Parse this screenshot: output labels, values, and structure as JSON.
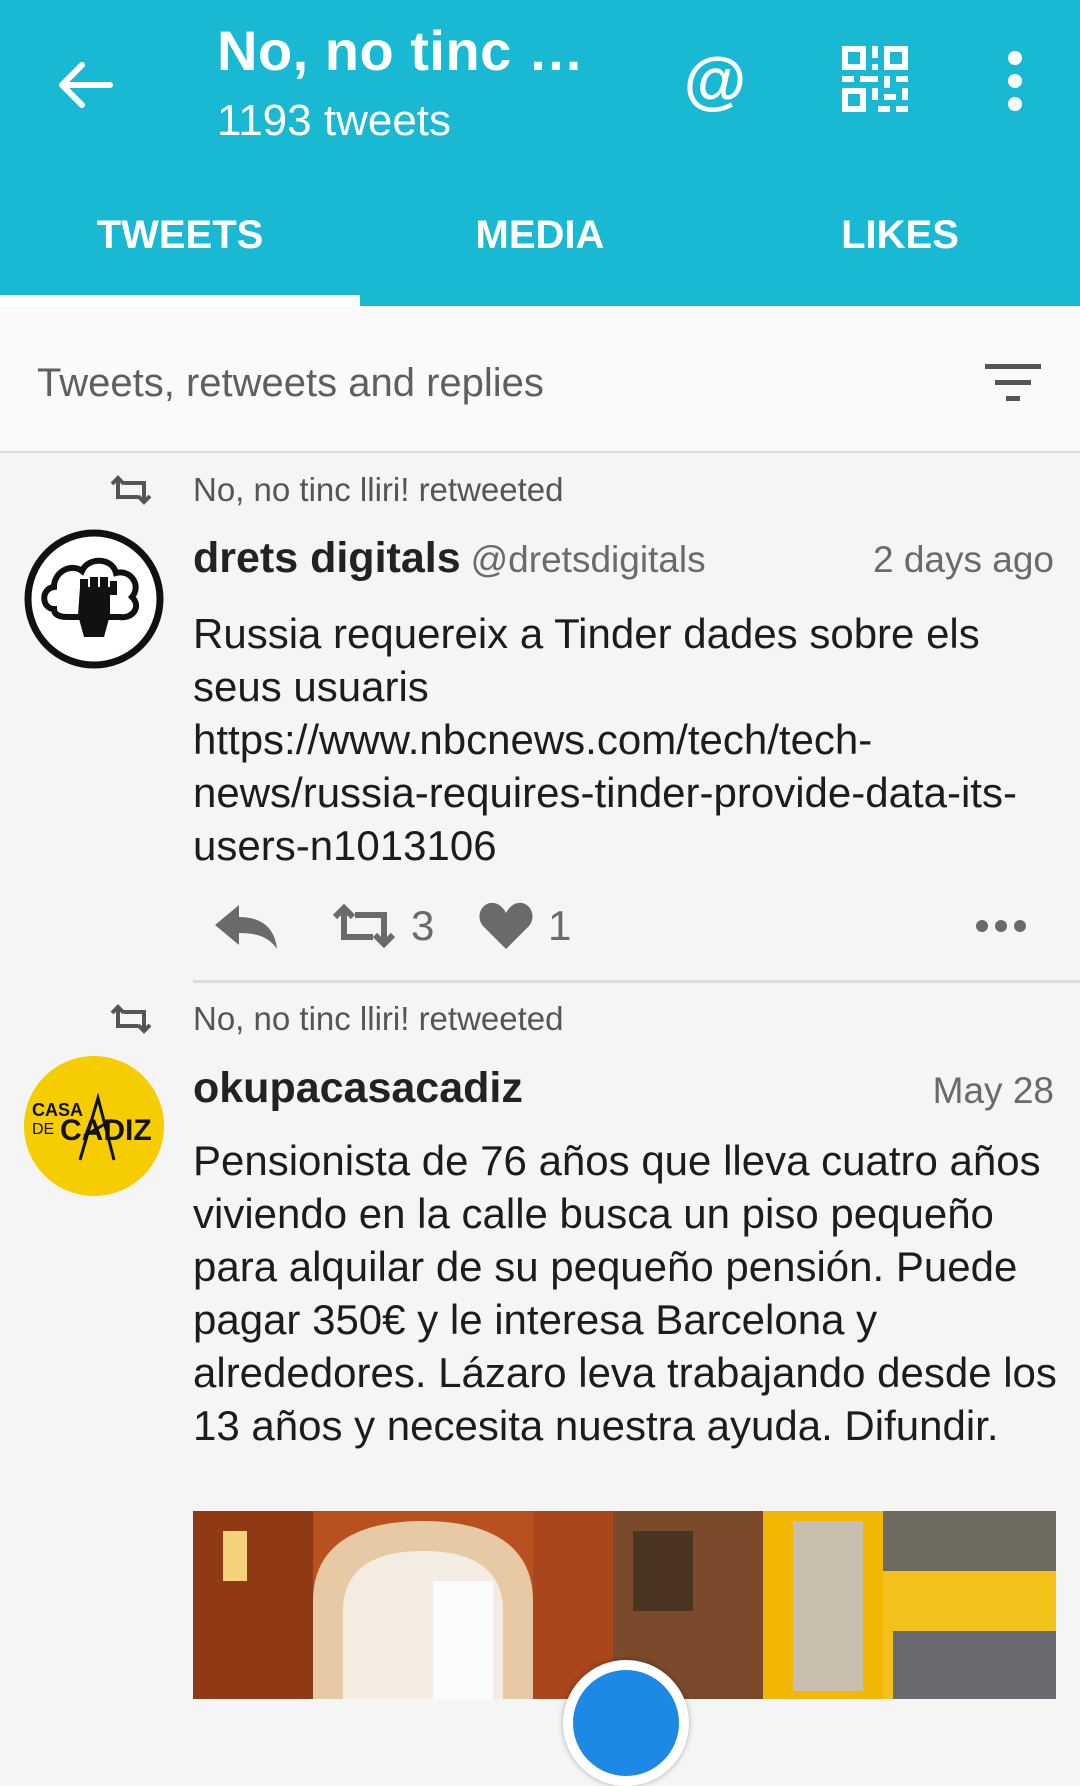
{
  "header": {
    "title": "No, no tinc ll…",
    "subtitle": "1193 tweets",
    "at_symbol": "@"
  },
  "tabs": [
    {
      "label": "TWEETS",
      "active": true
    },
    {
      "label": "MEDIA",
      "active": false
    },
    {
      "label": "LIKES",
      "active": false
    }
  ],
  "filter": {
    "label": "Tweets, retweets and replies"
  },
  "tweets": [
    {
      "retweeted_by": "No, no tinc lliri! retweeted",
      "author": "drets digitals",
      "handle": "@dretsdigitals",
      "time": "2 days ago",
      "text": "Russia requereix a Tinder dades sobre els seus usuaris https://www.nbcnews.com/tech/tech-news/russia-requires-tinder-provide-data-its-users-n1013106",
      "retweets": "3",
      "likes": "1"
    },
    {
      "retweeted_by": "No, no tinc lliri! retweeted",
      "author": "okupacasacadiz",
      "handle": "",
      "time": "May 28",
      "text": "Pensionista de 76 años que lleva cuatro años viviendo en la calle busca un piso pequeño para alquilar de su pequeño pensión. Puede pagar 350€ y le interesa Barcelona y alrededores. Lázaro leva trabajando desde los 13 años y necesita nuestra ayuda. Difundir.",
      "avatar_text": {
        "line1": "CASA",
        "line2": "DE",
        "line3": "CADIZ"
      }
    }
  ],
  "colors": {
    "appbar": "#19b8d3",
    "avatar_yellow": "#f5cd00",
    "fab_blue": "#1e88e5"
  }
}
